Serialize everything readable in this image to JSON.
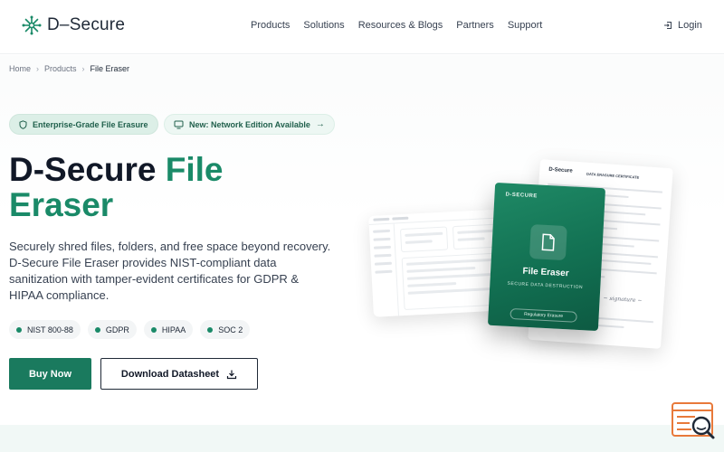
{
  "header": {
    "logo_text": "D–Secure",
    "logo_icon": "asterisk-network-icon",
    "nav": [
      "Products",
      "Solutions",
      "Resources & Blogs",
      "Partners",
      "Support"
    ],
    "login_label": "Login",
    "login_icon": "login-icon"
  },
  "breadcrumb": {
    "items": [
      "Home",
      "Products"
    ],
    "current": "File Eraser"
  },
  "hero": {
    "pill_primary": "Enterprise-Grade File Erasure",
    "pill_primary_icon": "shield-icon",
    "pill_secondary": "New: Network Edition Available",
    "pill_secondary_icon": "monitor-icon",
    "title_part1": "D-Secure",
    "title_accent": "File Eraser",
    "description": "Securely shred files, folders, and free space beyond recovery. D-Secure File Eraser provides NIST-compliant data sanitization with tamper-evident certificates for GDPR & HIPAA compliance.",
    "badges": [
      "NIST 800-88",
      "GDPR",
      "HIPAA",
      "SOC 2"
    ],
    "buy_label": "Buy Now",
    "datasheet_label": "Download Datasheet",
    "datasheet_icon": "download-icon"
  },
  "illustration": {
    "box_brand": "D-SECURE",
    "box_title": "File Eraser",
    "box_subtitle": "SECURE DATA DESTRUCTION",
    "box_label": "Regulatory Erasure",
    "cert_logo": "D-Secure",
    "cert_title": "DATA ERASURE CERTIFICATE"
  },
  "colors": {
    "accent": "#1a8a68",
    "primary_button": "#1a7a5e",
    "widget": "#e8793a"
  }
}
